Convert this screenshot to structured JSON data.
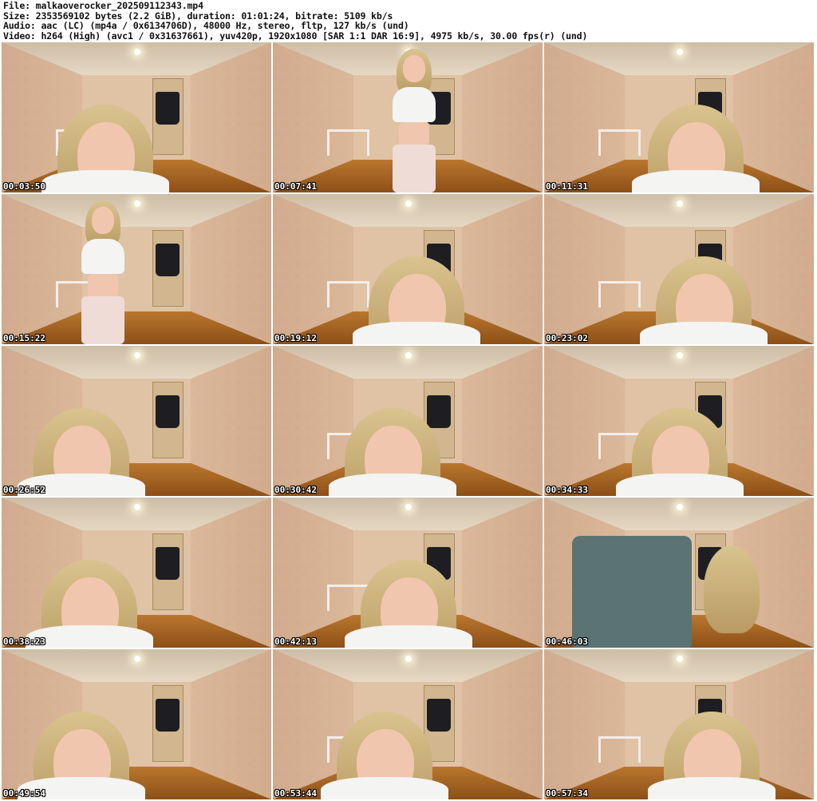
{
  "header": {
    "file_line": "File: malkaoverocker_202509112343.mp4",
    "size_line": "Size: 2353569102 bytes (2.2 GiB), duration: 01:01:24, bitrate: 5109 kb/s",
    "audio_line": "Audio: aac (LC) (mp4a / 0x6134706D), 48000 Hz, stereo, fltp, 127 kb/s (und)",
    "video_line": "Video: h264 (High) (avc1 / 0x31637661), yuv420p, 1920x1080 [SAR 1:1 DAR 16:9], 4975 kb/s, 30.00 fps(r) (und)"
  },
  "thumbnails": [
    {
      "timestamp": "00:03:50",
      "pose": "close"
    },
    {
      "timestamp": "00:07:41",
      "pose": "standing"
    },
    {
      "timestamp": "00:11:31",
      "pose": "close"
    },
    {
      "timestamp": "00:15:22",
      "pose": "standing"
    },
    {
      "timestamp": "00:19:12",
      "pose": "close"
    },
    {
      "timestamp": "00:23:02",
      "pose": "close"
    },
    {
      "timestamp": "00:26:52",
      "pose": "close"
    },
    {
      "timestamp": "00:30:42",
      "pose": "close"
    },
    {
      "timestamp": "00:34:33",
      "pose": "close"
    },
    {
      "timestamp": "00:38:23",
      "pose": "close"
    },
    {
      "timestamp": "00:42:13",
      "pose": "close"
    },
    {
      "timestamp": "00:46:03",
      "pose": "garment"
    },
    {
      "timestamp": "00:49:54",
      "pose": "close"
    },
    {
      "timestamp": "00:53:44",
      "pose": "close"
    },
    {
      "timestamp": "00:57:34",
      "pose": "close"
    }
  ]
}
